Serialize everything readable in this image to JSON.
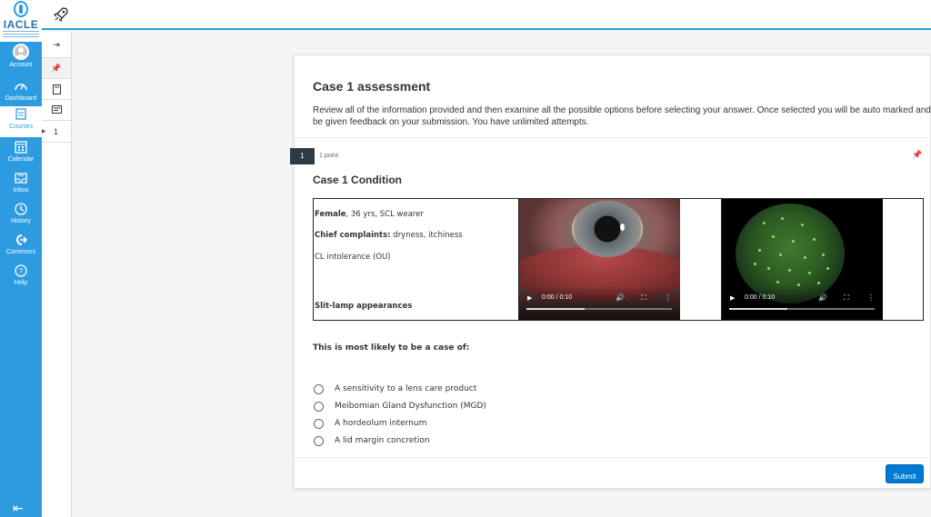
{
  "app": {
    "logo_text": "IACLE"
  },
  "global_nav": {
    "items": [
      {
        "label": "Account",
        "icon": "account-avatar-icon"
      },
      {
        "label": "Dashboard",
        "icon": "dashboard-icon"
      },
      {
        "label": "Courses",
        "icon": "courses-icon"
      },
      {
        "label": "Calendar",
        "icon": "calendar-icon"
      },
      {
        "label": "Inbox",
        "icon": "inbox-icon"
      },
      {
        "label": "History",
        "icon": "history-icon"
      },
      {
        "label": "Commons",
        "icon": "commons-icon"
      },
      {
        "label": "Help",
        "icon": "help-icon"
      }
    ],
    "active": "Courses",
    "accent": "#2d9be0"
  },
  "quiz_nav": {
    "question_number": "1"
  },
  "quiz": {
    "title": "Case 1 assessment",
    "intro": "Review all of the information provided and then examine all the possible options before selecting your answer. Once selected you will be auto marked and be given feedback on your submission. You have unlimited attempts.",
    "question": {
      "number": "1",
      "points": "1 point",
      "title": "Case 1 Condition",
      "patient": {
        "female_label": "Female",
        "female_rest": ", 36 yrs, SCL wearer",
        "complaints_label": "Chief complaints:",
        "complaints_rest": " dryness, itchiness",
        "intolerance": "CL intolerance (OU)",
        "slit_lamp": "Slit-lamp appearances"
      },
      "videos": [
        {
          "time": "0:00 / 0:10",
          "progress": 0.4
        },
        {
          "time": "0:00 / 0:10",
          "progress": 0.4
        }
      ],
      "prompt": "This is most likely to be a case of:",
      "answers": [
        "A sensitivity to a lens care product",
        "Meibomian Gland Dysfunction (MGD)",
        "A  hordeolum internum",
        "A lid margin concretion"
      ]
    },
    "submit_label": "Submit"
  }
}
